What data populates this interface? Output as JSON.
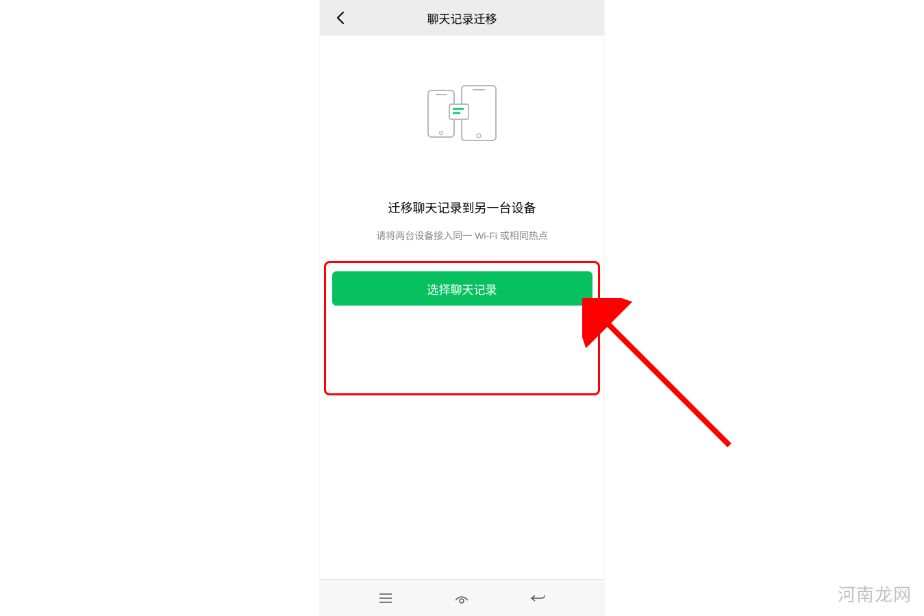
{
  "header": {
    "title": "聊天记录迁移"
  },
  "main": {
    "migrate_title": "迁移聊天记录到另一台设备",
    "migrate_subtitle": "请将两台设备接入同一 Wi-Fi 或相同热点",
    "select_button_label": "选择聊天记录"
  },
  "watermark": "河南龙网",
  "colors": {
    "accent_green": "#07c160",
    "highlight_red": "#ff0000",
    "header_bg": "#ededed",
    "subtitle_grey": "#888888"
  }
}
